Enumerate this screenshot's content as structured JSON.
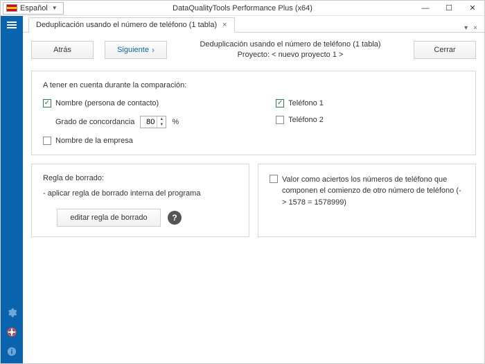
{
  "titlebar": {
    "language": "Español",
    "app_title": "DataQualityTools Performance Plus (x64)"
  },
  "tab": {
    "label": "Deduplicación usando el número de teléfono (1 tabla)"
  },
  "nav": {
    "back": "Atrás",
    "next": "Siguiente",
    "title_line1": "Deduplicación usando el número de teléfono (1 tabla)",
    "title_line2": "Proyecto: < nuevo proyecto 1 >",
    "close": "Cerrar"
  },
  "compare": {
    "title": "A tener en cuenta durante la comparación:",
    "contact_name": "Nombre (persona de contacto)",
    "concordance_label": "Grado de concordancia",
    "concordance_value": "80",
    "percent": "%",
    "company_name": "Nombre de la empresa",
    "phone1": "Teléfono 1",
    "phone2": "Teléfono 2"
  },
  "delete_rule": {
    "title": "Regla de borrado:",
    "desc": "- aplicar regla de borrado interna del programa",
    "edit_btn": "editar regla de borrado"
  },
  "hits": {
    "text": "Valor como aciertos los números de teléfono que componen el comienzo de otro número de teléfono (-> 1578 = 1578999)"
  }
}
